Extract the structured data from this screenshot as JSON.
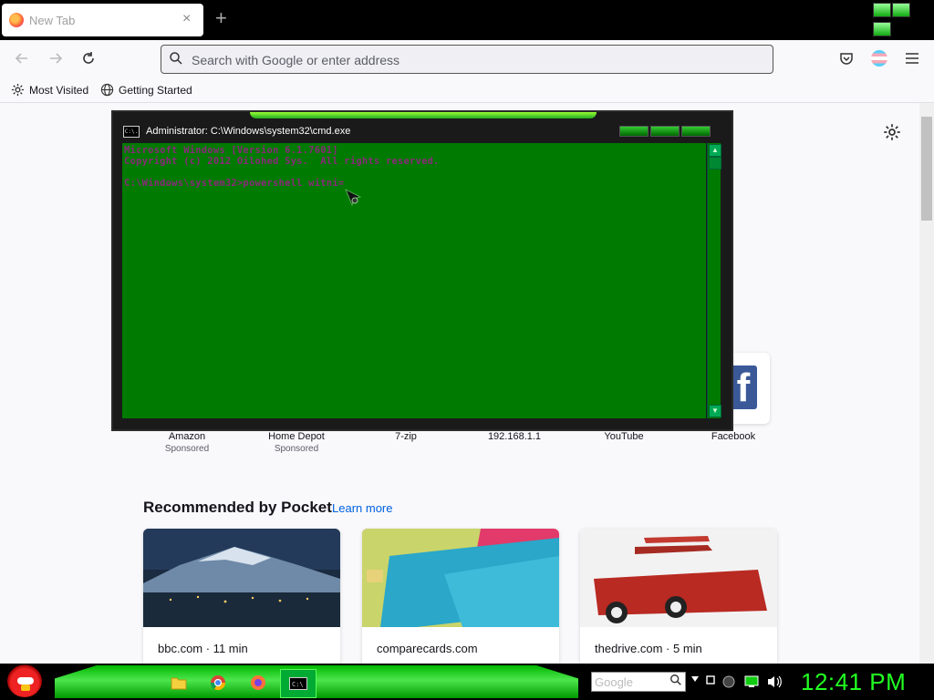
{
  "browser": {
    "tab_title": "New Tab",
    "new_tab_symbol": "+",
    "close_symbol": "×",
    "url_placeholder": "Search with Google or enter address",
    "bookmarks": [
      {
        "label": "Most Visited",
        "icon": "gear-icon"
      },
      {
        "label": "Getting Started",
        "icon": "globe-icon"
      }
    ]
  },
  "top_sites": [
    {
      "name": "Amazon",
      "sponsored": "Sponsored"
    },
    {
      "name": "Home Depot",
      "sponsored": "Sponsored"
    },
    {
      "name": "7-zip",
      "sponsored": ""
    },
    {
      "name": "192.168.1.1",
      "sponsored": ""
    },
    {
      "name": "YouTube",
      "sponsored": ""
    },
    {
      "name": "Facebook",
      "sponsored": ""
    }
  ],
  "pocket": {
    "title": "Recommended by Pocket",
    "learn_more": "Learn more",
    "cards": [
      {
        "source": "bbc.com · 11 min",
        "image": "snowy-mountain-town-night"
      },
      {
        "source": "comparecards.com",
        "image": "credit-cards"
      },
      {
        "source": "thedrive.com · 5 min",
        "image": "red-antarctic-vehicle-with-plane"
      }
    ]
  },
  "cmd": {
    "title": "Administrator: C:\\Windows\\system32\\cmd.exe",
    "icon_text": "C:\\.",
    "lines": [
      "Microsoft Windows [Version 6.1.7601]",
      "Copyright (c) 2012 Oilohed Sys.  All rights reserved.",
      "",
      "C:\\Windows\\system32>powershell witni="
    ]
  },
  "taskbar": {
    "search_placeholder": "Google",
    "clock": "12:41 PM",
    "apps": [
      "folder-icon",
      "chrome-icon",
      "firefox-icon",
      "cmd-icon"
    ]
  },
  "colors": {
    "console_bg": "#007a00",
    "console_text": "#8a2a7a",
    "clock": "#22ff22",
    "link": "#0061e0",
    "facebook": "#3b5998"
  }
}
